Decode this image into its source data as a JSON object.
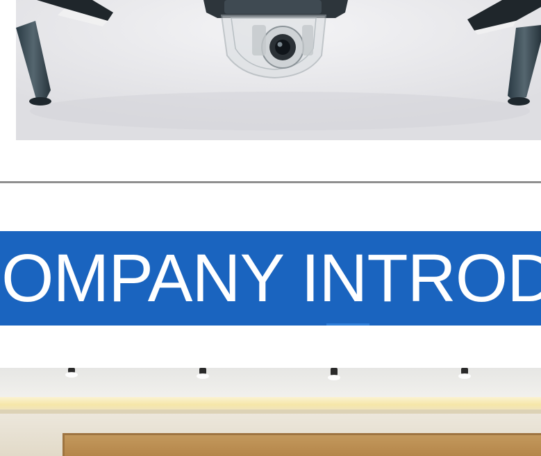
{
  "section_banner": {
    "title": "OMPANY INTROD"
  },
  "images": {
    "drone_photo": "drone-product-photo",
    "office_photo": "office-interior-photo"
  },
  "colors": {
    "banner_background": "#1a64bf",
    "banner_text": "#ffffff",
    "divider": "#8f8f8f",
    "page_background": "#ffffff"
  }
}
